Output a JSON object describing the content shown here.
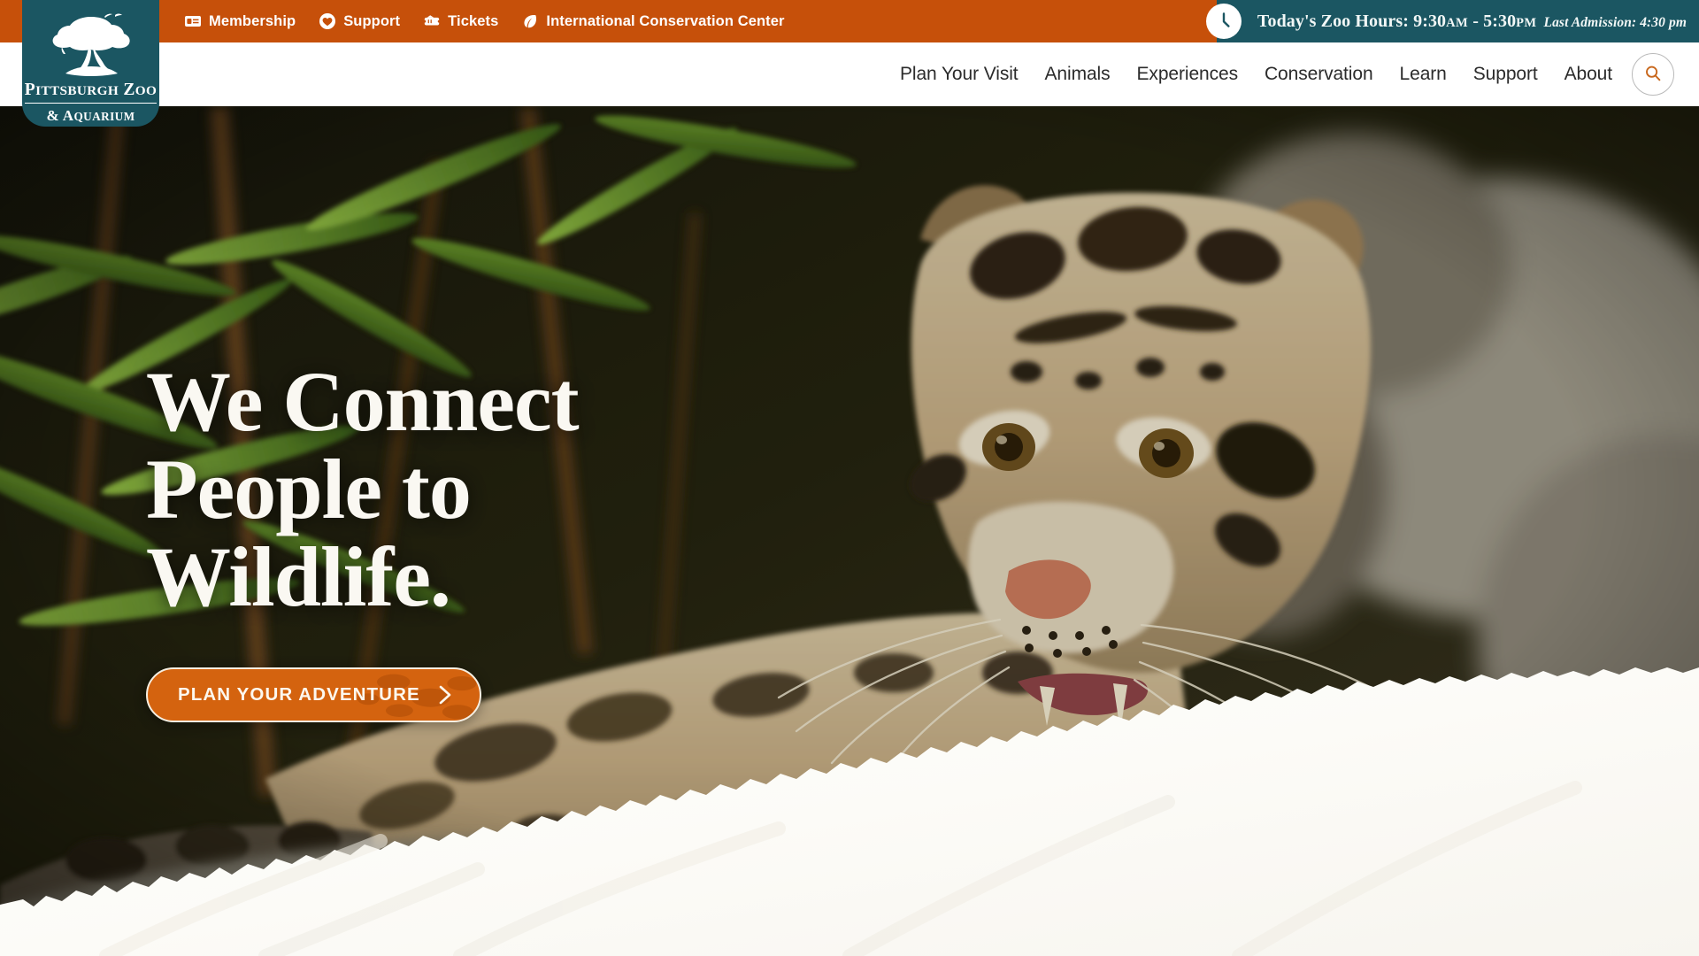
{
  "colors": {
    "orange": "#c6500a",
    "teal": "#1b5662",
    "cta_orange": "#d4630f",
    "cream": "#faf8f2",
    "nav_text": "#2b2b2b"
  },
  "topbar": {
    "links": [
      {
        "label": "Membership",
        "icon": "membership-card-icon"
      },
      {
        "label": "Support",
        "icon": "heart-icon"
      },
      {
        "label": "Tickets",
        "icon": "ticket-icon"
      },
      {
        "label": "International Conservation Center",
        "icon": "leaf-icon"
      }
    ],
    "hours": {
      "icon": "clock-icon",
      "label": "Today's Zoo Hours:",
      "open_time": "9:30",
      "open_meridiem": "AM",
      "dash": "-",
      "close_time": "5:30",
      "close_meridiem": "PM",
      "last_admission": "Last Admission: 4:30 pm"
    }
  },
  "logo": {
    "icon": "tree-icon",
    "name": "Pittsburgh Zoo",
    "subtitle": "& Aquarium"
  },
  "nav": {
    "items": [
      {
        "label": "Plan Your Visit"
      },
      {
        "label": "Animals"
      },
      {
        "label": "Experiences"
      },
      {
        "label": "Conservation"
      },
      {
        "label": "Learn"
      },
      {
        "label": "Support"
      },
      {
        "label": "About"
      }
    ],
    "search": {
      "icon": "search-icon",
      "aria": "Search"
    }
  },
  "hero": {
    "title_line1": "We Connect",
    "title_line2": "People to",
    "title_line3": "Wildlife.",
    "cta_label": "PLAN YOUR ADVENTURE",
    "cta_icon": "chevron-right-icon",
    "image_alt": "clouded-leopard-in-bamboo"
  }
}
